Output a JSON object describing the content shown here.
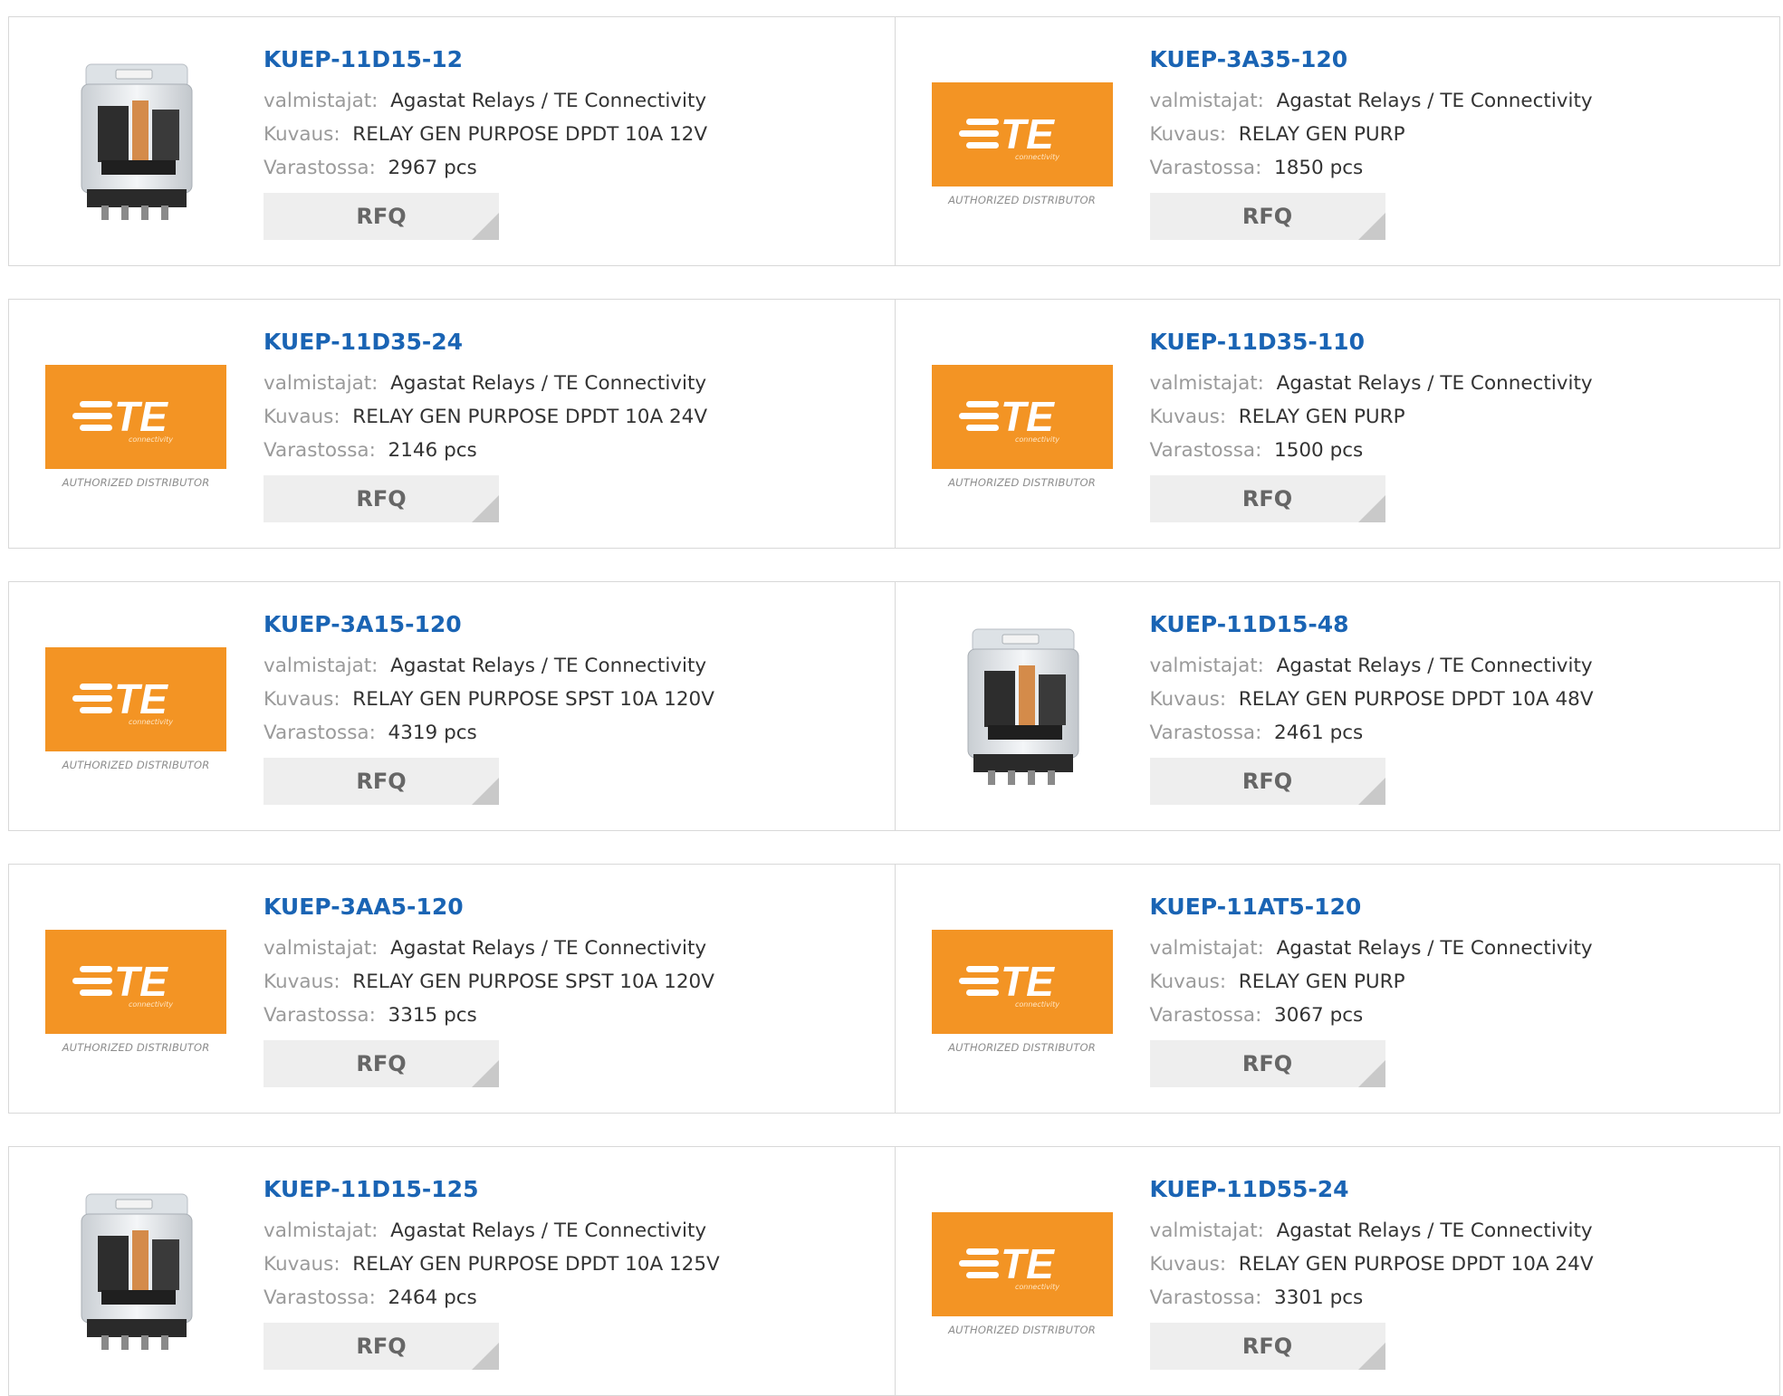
{
  "labels": {
    "manufacturer": "valmistajat:",
    "description": "Kuvaus:",
    "stock": "Varastossa:",
    "rfq": "RFQ",
    "te_sub": "connectivity",
    "te_authorized": "AUTHORIZED DISTRIBUTOR"
  },
  "colors": {
    "part_link": "#1a64b4",
    "te_orange": "#f39424",
    "border": "#d8d8d8",
    "rfq_bg": "#eeeeee"
  },
  "products": [
    {
      "part": "KUEP-11D15-12",
      "manufacturer": "Agastat Relays / TE Connectivity",
      "description": "RELAY GEN PURPOSE DPDT 10A 12V",
      "stock": "2967 pcs",
      "image": "relay-photo"
    },
    {
      "part": "KUEP-3A35-120",
      "manufacturer": "Agastat Relays / TE Connectivity",
      "description": "RELAY GEN PURP",
      "stock": "1850 pcs",
      "image": "te-logo"
    },
    {
      "part": "KUEP-11D35-24",
      "manufacturer": "Agastat Relays / TE Connectivity",
      "description": "RELAY GEN PURPOSE DPDT 10A 24V",
      "stock": "2146 pcs",
      "image": "te-logo"
    },
    {
      "part": "KUEP-11D35-110",
      "manufacturer": "Agastat Relays / TE Connectivity",
      "description": "RELAY GEN PURP",
      "stock": "1500 pcs",
      "image": "te-logo"
    },
    {
      "part": "KUEP-3A15-120",
      "manufacturer": "Agastat Relays / TE Connectivity",
      "description": "RELAY GEN PURPOSE SPST 10A 120V",
      "stock": "4319 pcs",
      "image": "te-logo"
    },
    {
      "part": "KUEP-11D15-48",
      "manufacturer": "Agastat Relays / TE Connectivity",
      "description": "RELAY GEN PURPOSE DPDT 10A 48V",
      "stock": "2461 pcs",
      "image": "relay-photo"
    },
    {
      "part": "KUEP-3AA5-120",
      "manufacturer": "Agastat Relays / TE Connectivity",
      "description": "RELAY GEN PURPOSE SPST 10A 120V",
      "stock": "3315 pcs",
      "image": "te-logo"
    },
    {
      "part": "KUEP-11AT5-120",
      "manufacturer": "Agastat Relays / TE Connectivity",
      "description": "RELAY GEN PURP",
      "stock": "3067 pcs",
      "image": "te-logo"
    },
    {
      "part": "KUEP-11D15-125",
      "manufacturer": "Agastat Relays / TE Connectivity",
      "description": "RELAY GEN PURPOSE DPDT 10A 125V",
      "stock": "2464 pcs",
      "image": "relay-photo"
    },
    {
      "part": "KUEP-11D55-24",
      "manufacturer": "Agastat Relays / TE Connectivity",
      "description": "RELAY GEN PURPOSE DPDT 10A 24V",
      "stock": "3301 pcs",
      "image": "te-logo"
    }
  ]
}
